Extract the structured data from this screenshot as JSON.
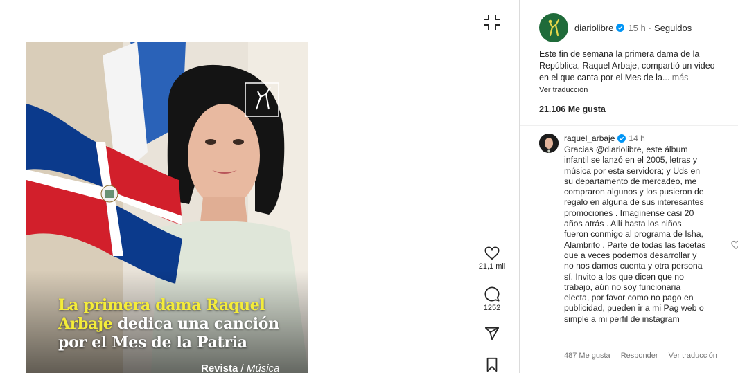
{
  "post": {
    "headline_highlight": "La primera dama Raquel Arbaje",
    "headline_rest": "dedica una canción por el Mes de la Patria",
    "section_bold": "Revista",
    "section_sep": " / ",
    "section_sub": "Música"
  },
  "actions": {
    "likes_count": "21,1 mil",
    "comments_count": "1252"
  },
  "header": {
    "username": "diariolibre",
    "time": "15 h",
    "separator": "·",
    "following": "Seguidos"
  },
  "caption": {
    "text": "Este fin de semana la primera dama de la República, Raquel Arbaje, compartió un video en el que canta por el Mes de la...",
    "more": "más",
    "see_translation": "Ver traducción"
  },
  "likes_label": "21.106 Me gusta",
  "comment": {
    "username": "raquel_arbaje",
    "time": "14 h",
    "text": "Gracias @diariolibre, este álbum infantil se lanzó en el 2005, letras y música por esta servidora; y Uds en su departamento de mercadeo, me compraron algunos y los pusieron de regalo en alguna de sus interesantes promociones . Imagínense casi 20 años atrás . Allí hasta los niños fueron conmigo al programa de Isha, Alambrito . Parte de todas las facetas que a veces podemos desarrollar y no nos damos cuenta y otra persona sí. Invito a los que dicen que no trabajo, aún no soy funcionaria electa, por favor como no pago en publicidad, pueden ir a mi Pag web o simple a mi perfil de instagram",
    "likes": "487 Me gusta",
    "reply": "Responder",
    "see_translation": "Ver traducción"
  },
  "colors": {
    "brand_green": "#1f6b3a",
    "verified_blue": "#0095f6",
    "headline_yellow": "#f4ec3a",
    "flag_blue": "#0b3a8c",
    "flag_red": "#d21f2b"
  }
}
